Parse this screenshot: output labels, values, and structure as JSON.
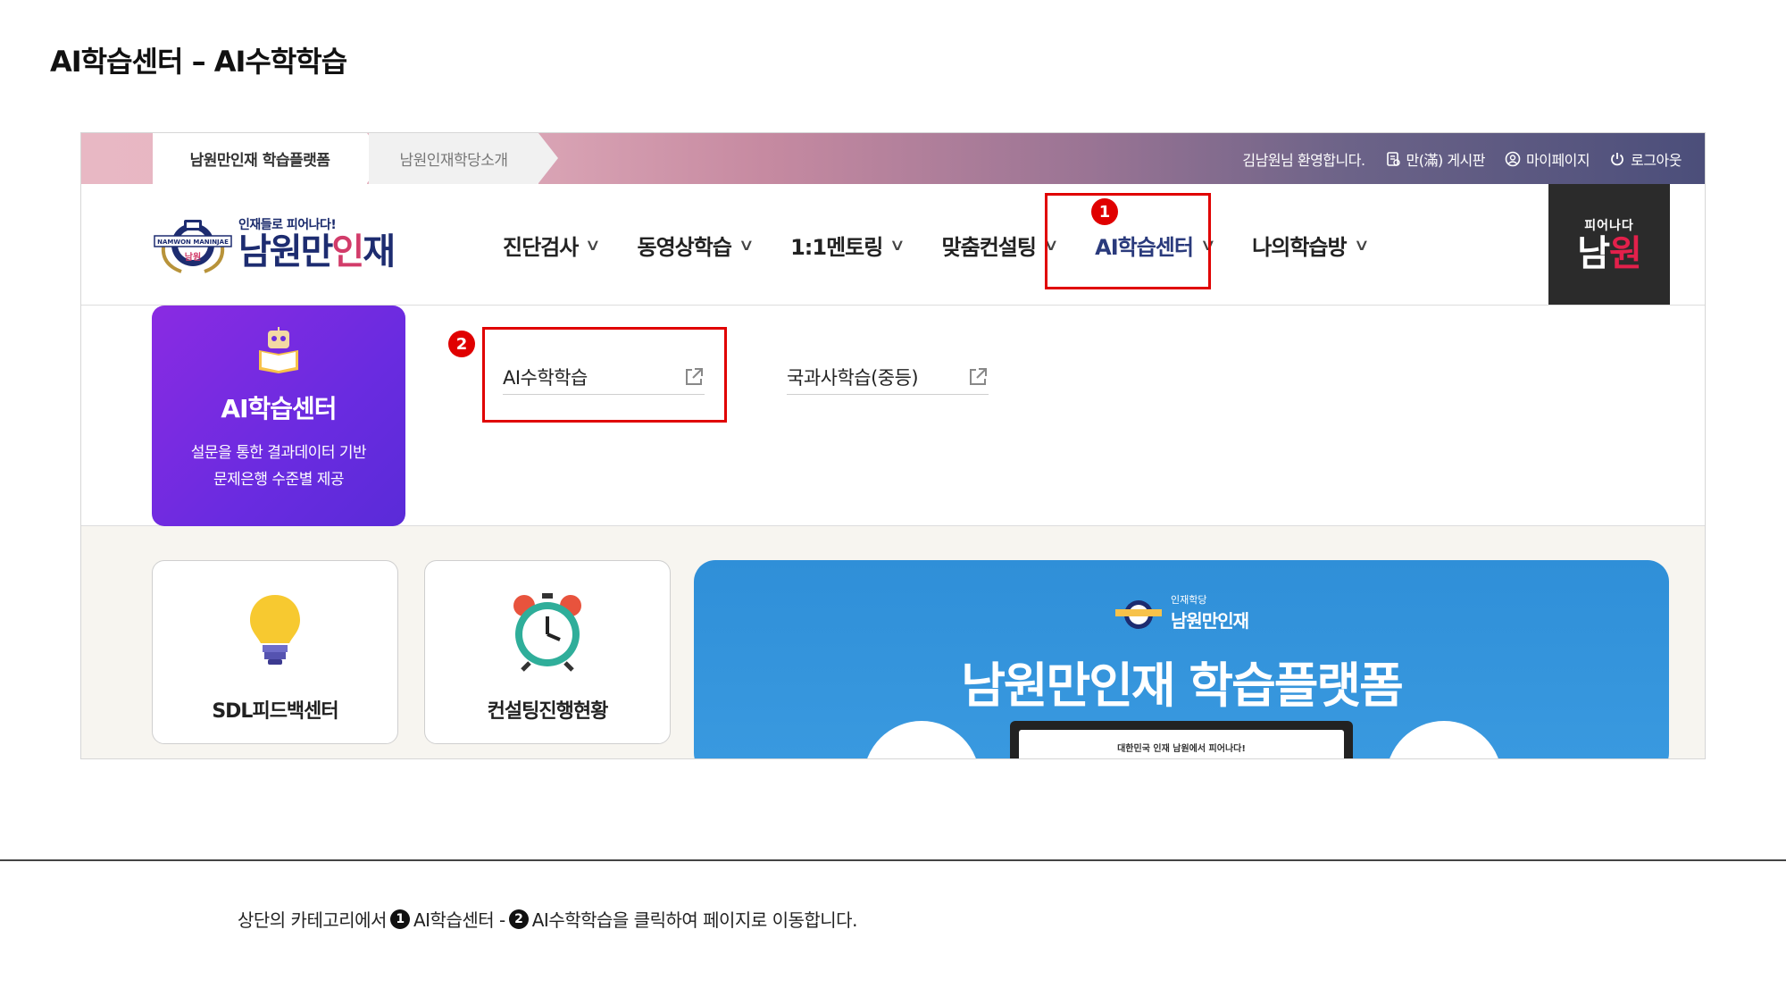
{
  "page": {
    "title": "AI학습센터 – AI수학학습"
  },
  "topbar": {
    "tab_platform": "남원만인재 학습플랫폼",
    "tab_intro": "남원인재학당소개",
    "welcome": "김남원님 환영합니다.",
    "board": "만(滿) 게시판",
    "mypage": "마이페이지",
    "logout": "로그아웃"
  },
  "logo": {
    "tagline": "인재들로 피어나다!",
    "name_main": "남원만",
    "name_accent": "인",
    "name_tail": "재",
    "emblem_text": "NAMWON MANINJAE"
  },
  "nav": {
    "items": [
      {
        "label": "진단검사"
      },
      {
        "label": "동영상학습"
      },
      {
        "label": "1:1멘토링"
      },
      {
        "label": "맞춤컨설팅"
      },
      {
        "label": "AI학습센터"
      },
      {
        "label": "나의학습방"
      }
    ]
  },
  "brand_box": {
    "line1": "피어나다",
    "line2_a": "남",
    "line2_b": "원"
  },
  "markers": {
    "one": "1",
    "two": "2"
  },
  "dropdown": {
    "panel_title": "AI학습센터",
    "panel_desc_1": "설문을 통한 결과데이터 기반",
    "panel_desc_2": "문제은행 수준별 제공",
    "links": [
      {
        "label": "AI수학학습"
      },
      {
        "label": "국과사학습(중등)"
      }
    ]
  },
  "cards": [
    {
      "label": "SDL피드백센터"
    },
    {
      "label": "컨설팅진행현황"
    }
  ],
  "banner": {
    "logo_small": "인재학당",
    "logo_big": "남원만인재",
    "title": "남원만인재 학습플랫폼",
    "screen_text": "대한민국 인재 남원에서 피어나다!"
  },
  "caption": {
    "part1": "상단의 카테고리에서",
    "num1": "1",
    "part2": "AI학습센터 -",
    "num2": "2",
    "part3": "AI수학학습을 클릭하여 페이지로 이동합니다."
  },
  "colors": {
    "highlight": "#e00000",
    "purple_panel": "#6a2be0",
    "banner_blue": "#3a9ae0",
    "navy": "#1d2c70"
  }
}
